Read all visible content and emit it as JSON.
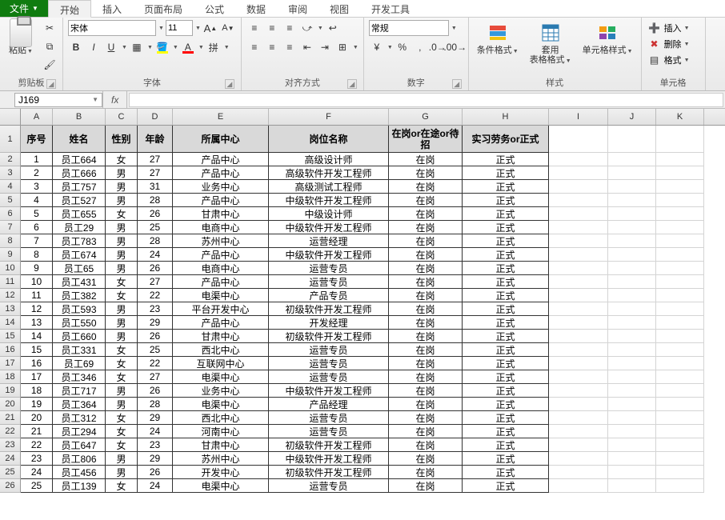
{
  "menu": {
    "file": "文件",
    "tabs": [
      "开始",
      "插入",
      "页面布局",
      "公式",
      "数据",
      "审阅",
      "视图",
      "开发工具"
    ],
    "active": 0
  },
  "ribbon": {
    "clipboard": {
      "paste": "粘贴",
      "label": "剪贴板"
    },
    "font": {
      "name": "宋体",
      "size": "11",
      "bold": "B",
      "italic": "I",
      "underline": "U",
      "label": "字体"
    },
    "align": {
      "label": "对齐方式",
      "wrap": "自动换行",
      "merge": "合并后居中"
    },
    "number": {
      "format": "常规",
      "label": "数字"
    },
    "styles": {
      "cond": "条件格式",
      "table": "套用\n表格格式",
      "cell": "单元格样式",
      "label": "样式"
    },
    "cells": {
      "insert": "插入",
      "delete": "删除",
      "format": "格式",
      "label": "单元格"
    }
  },
  "namebox": "J169",
  "formula": "",
  "columns": [
    "A",
    "B",
    "C",
    "D",
    "E",
    "F",
    "G",
    "H",
    "I",
    "J",
    "K"
  ],
  "headers": [
    "序号",
    "姓名",
    "性别",
    "年龄",
    "所属中心",
    "岗位名称",
    "在岗or在途or待招",
    "实习劳务or正式"
  ],
  "rows": [
    {
      "n": 1,
      "d": [
        "1",
        "员工664",
        "女",
        "27",
        "产品中心",
        "高级设计师",
        "在岗",
        "正式"
      ]
    },
    {
      "n": 2,
      "d": [
        "2",
        "员工666",
        "男",
        "27",
        "产品中心",
        "高级软件开发工程师",
        "在岗",
        "正式"
      ]
    },
    {
      "n": 3,
      "d": [
        "3",
        "员工757",
        "男",
        "31",
        "业务中心",
        "高级测试工程师",
        "在岗",
        "正式"
      ]
    },
    {
      "n": 4,
      "d": [
        "4",
        "员工527",
        "男",
        "28",
        "产品中心",
        "中级软件开发工程师",
        "在岗",
        "正式"
      ]
    },
    {
      "n": 5,
      "d": [
        "5",
        "员工655",
        "女",
        "26",
        "甘肃中心",
        "中级设计师",
        "在岗",
        "正式"
      ]
    },
    {
      "n": 6,
      "d": [
        "6",
        "员工29",
        "男",
        "25",
        "电商中心",
        "中级软件开发工程师",
        "在岗",
        "正式"
      ]
    },
    {
      "n": 7,
      "d": [
        "7",
        "员工783",
        "男",
        "28",
        "苏州中心",
        "运营经理",
        "在岗",
        "正式"
      ]
    },
    {
      "n": 8,
      "d": [
        "8",
        "员工674",
        "男",
        "24",
        "产品中心",
        "中级软件开发工程师",
        "在岗",
        "正式"
      ]
    },
    {
      "n": 9,
      "d": [
        "9",
        "员工65",
        "男",
        "26",
        "电商中心",
        "运营专员",
        "在岗",
        "正式"
      ]
    },
    {
      "n": 10,
      "d": [
        "10",
        "员工431",
        "女",
        "27",
        "产品中心",
        "运营专员",
        "在岗",
        "正式"
      ]
    },
    {
      "n": 11,
      "d": [
        "11",
        "员工382",
        "女",
        "22",
        "电渠中心",
        "产品专员",
        "在岗",
        "正式"
      ]
    },
    {
      "n": 12,
      "d": [
        "12",
        "员工593",
        "男",
        "23",
        "平台开发中心",
        "初级软件开发工程师",
        "在岗",
        "正式"
      ]
    },
    {
      "n": 13,
      "d": [
        "13",
        "员工550",
        "男",
        "29",
        "产品中心",
        "开发经理",
        "在岗",
        "正式"
      ]
    },
    {
      "n": 14,
      "d": [
        "14",
        "员工660",
        "男",
        "26",
        "甘肃中心",
        "初级软件开发工程师",
        "在岗",
        "正式"
      ]
    },
    {
      "n": 15,
      "d": [
        "15",
        "员工331",
        "女",
        "25",
        "西北中心",
        "运营专员",
        "在岗",
        "正式"
      ]
    },
    {
      "n": 16,
      "d": [
        "16",
        "员工69",
        "女",
        "22",
        "互联网中心",
        "运营专员",
        "在岗",
        "正式"
      ]
    },
    {
      "n": 17,
      "d": [
        "17",
        "员工346",
        "女",
        "27",
        "电渠中心",
        "运营专员",
        "在岗",
        "正式"
      ]
    },
    {
      "n": 18,
      "d": [
        "18",
        "员工717",
        "男",
        "26",
        "业务中心",
        "中级软件开发工程师",
        "在岗",
        "正式"
      ]
    },
    {
      "n": 19,
      "d": [
        "19",
        "员工364",
        "男",
        "28",
        "电渠中心",
        "产品经理",
        "在岗",
        "正式"
      ]
    },
    {
      "n": 20,
      "d": [
        "20",
        "员工312",
        "女",
        "29",
        "西北中心",
        "运营专员",
        "在岗",
        "正式"
      ]
    },
    {
      "n": 21,
      "d": [
        "21",
        "员工294",
        "女",
        "24",
        "河南中心",
        "运营专员",
        "在岗",
        "正式"
      ]
    },
    {
      "n": 22,
      "d": [
        "22",
        "员工647",
        "女",
        "23",
        "甘肃中心",
        "初级软件开发工程师",
        "在岗",
        "正式"
      ]
    },
    {
      "n": 23,
      "d": [
        "23",
        "员工806",
        "男",
        "29",
        "苏州中心",
        "中级软件开发工程师",
        "在岗",
        "正式"
      ]
    },
    {
      "n": 24,
      "d": [
        "24",
        "员工456",
        "男",
        "26",
        "开发中心",
        "初级软件开发工程师",
        "在岗",
        "正式"
      ]
    },
    {
      "n": 25,
      "d": [
        "25",
        "员工139",
        "女",
        "24",
        "电渠中心",
        "运营专员",
        "在岗",
        "正式"
      ]
    }
  ]
}
